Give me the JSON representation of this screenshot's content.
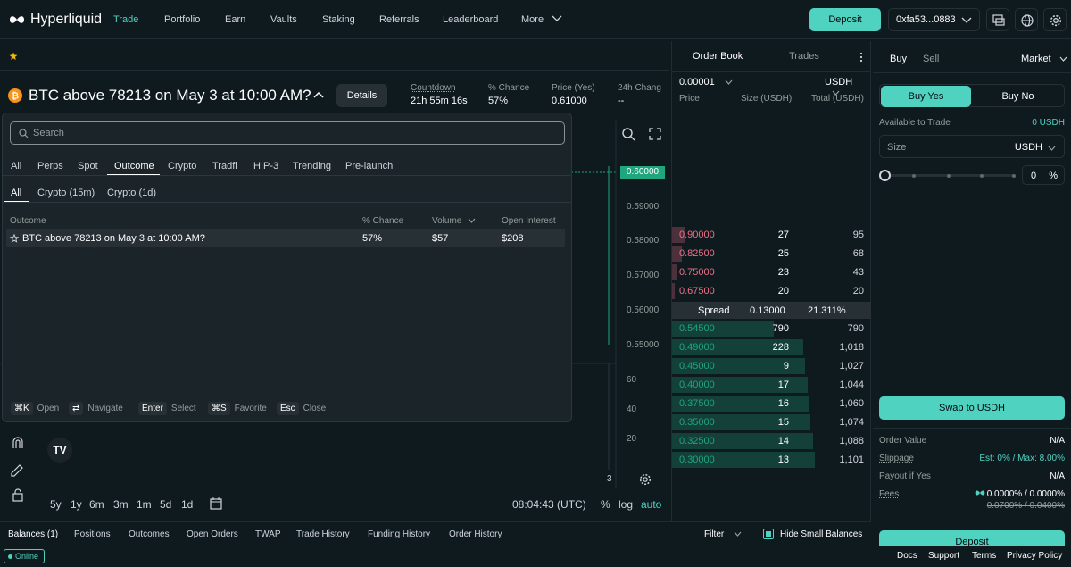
{
  "nav": {
    "brand": "Hyperliquid",
    "items": [
      "Trade",
      "Portfolio",
      "Earn",
      "Vaults",
      "Staking",
      "Referrals",
      "Leaderboard",
      "More"
    ],
    "deposit": "Deposit",
    "wallet": "0xfa53...0883"
  },
  "market": {
    "title": "BTC above 78213 on May 3 at 10:00 AM?",
    "details": "Details",
    "stats": [
      {
        "k": "Countdown",
        "v": "21h 55m 16s"
      },
      {
        "k": "% Chance",
        "v": "57%"
      },
      {
        "k": "Price (Yes)",
        "v": "0.61000"
      },
      {
        "k": "24h Chang",
        "v": "--"
      }
    ]
  },
  "chart": {
    "current_price": "0.60000",
    "axis": [
      "0.59000",
      "0.58000",
      "0.57000",
      "0.56000",
      "0.55000"
    ],
    "vol_axis": [
      "60",
      "40",
      "20"
    ],
    "last_tick": "3",
    "timeframes": [
      "5y",
      "1y",
      "6m",
      "3m",
      "1m",
      "5d",
      "1d"
    ],
    "clock": "08:04:43 (UTC)",
    "pct": "%",
    "log": "log",
    "auto": "auto"
  },
  "modal": {
    "search_placeholder": "Search",
    "tabs": [
      "All",
      "Perps",
      "Spot",
      "Outcome",
      "Crypto",
      "Tradfi",
      "HIP-3",
      "Trending",
      "Pre-launch"
    ],
    "subtabs": [
      "All",
      "Crypto (15m)",
      "Crypto (1d)"
    ],
    "columns": [
      "Outcome",
      "% Chance",
      "Volume",
      "Open Interest"
    ],
    "rows": [
      {
        "name": "BTC above 78213 on May 3 at 10:00 AM?",
        "chance": "57%",
        "volume": "$57",
        "oi": "$208"
      }
    ],
    "shortcuts": [
      {
        "k": "⌘K",
        "v": "Open"
      },
      {
        "k": "⇄",
        "v": "Navigate"
      },
      {
        "k": "Enter",
        "v": "Select"
      },
      {
        "k": "⌘S",
        "v": "Favorite"
      },
      {
        "k": "Esc",
        "v": "Close"
      }
    ]
  },
  "orderbook": {
    "tabs": [
      "Order Book",
      "Trades"
    ],
    "tick": "0.00001",
    "unit": "USDH",
    "headers": [
      "Price",
      "Size (USDH)",
      "Total (USDH)"
    ],
    "asks": [
      {
        "p": "0.90000",
        "s": "27",
        "t": "95",
        "w": 0.09
      },
      {
        "p": "0.82500",
        "s": "25",
        "t": "68",
        "w": 0.07
      },
      {
        "p": "0.75000",
        "s": "23",
        "t": "43",
        "w": 0.04
      },
      {
        "p": "0.67500",
        "s": "20",
        "t": "20",
        "w": 0.02
      }
    ],
    "spread": {
      "label": "Spread",
      "value": "0.13000",
      "pct": "21.311%"
    },
    "bids": [
      {
        "p": "0.54500",
        "s": "790",
        "t": "790",
        "w": 0.71
      },
      {
        "p": "0.49000",
        "s": "228",
        "t": "1,018",
        "w": 0.92
      },
      {
        "p": "0.45000",
        "s": "9",
        "t": "1,027",
        "w": 0.93
      },
      {
        "p": "0.40000",
        "s": "17",
        "t": "1,044",
        "w": 0.95
      },
      {
        "p": "0.37500",
        "s": "16",
        "t": "1,060",
        "w": 0.96
      },
      {
        "p": "0.35000",
        "s": "15",
        "t": "1,074",
        "w": 0.97
      },
      {
        "p": "0.32500",
        "s": "14",
        "t": "1,088",
        "w": 0.99
      },
      {
        "p": "0.30000",
        "s": "13",
        "t": "1,101",
        "w": 1.0
      }
    ]
  },
  "trade": {
    "tabs": [
      "Buy",
      "Sell"
    ],
    "order_type": "Market",
    "buy_yes": "Buy Yes",
    "buy_no": "Buy No",
    "available_label": "Available to Trade",
    "available_value": "0 USDH",
    "size_label": "Size",
    "size_unit": "USDH",
    "slider_pct": "0",
    "pct_sign": "%",
    "swap": "Swap to USDH",
    "order_value_label": "Order Value",
    "order_value": "N/A",
    "slippage_label": "Slippage",
    "slippage_value": "Est: 0% / Max: 8.00%",
    "payout_label": "Payout if Yes",
    "payout_value": "N/A",
    "fees_label": "Fees",
    "fees_value": "0.0000% / 0.0000%",
    "fees_old": "0.0700% / 0.0400%",
    "deposit": "Deposit"
  },
  "bottom": {
    "tabs": [
      "Balances (1)",
      "Positions",
      "Outcomes",
      "Open Orders",
      "TWAP",
      "Trade History",
      "Funding History",
      "Order History"
    ],
    "filter": "Filter",
    "hide_small": "Hide Small Balances"
  },
  "footer": {
    "status": "Online",
    "links": [
      "Docs",
      "Support",
      "Terms",
      "Privacy Policy"
    ]
  },
  "colors": {
    "accent": "#50d2c1",
    "red": "#ed7088",
    "green": "#1fa67d"
  }
}
